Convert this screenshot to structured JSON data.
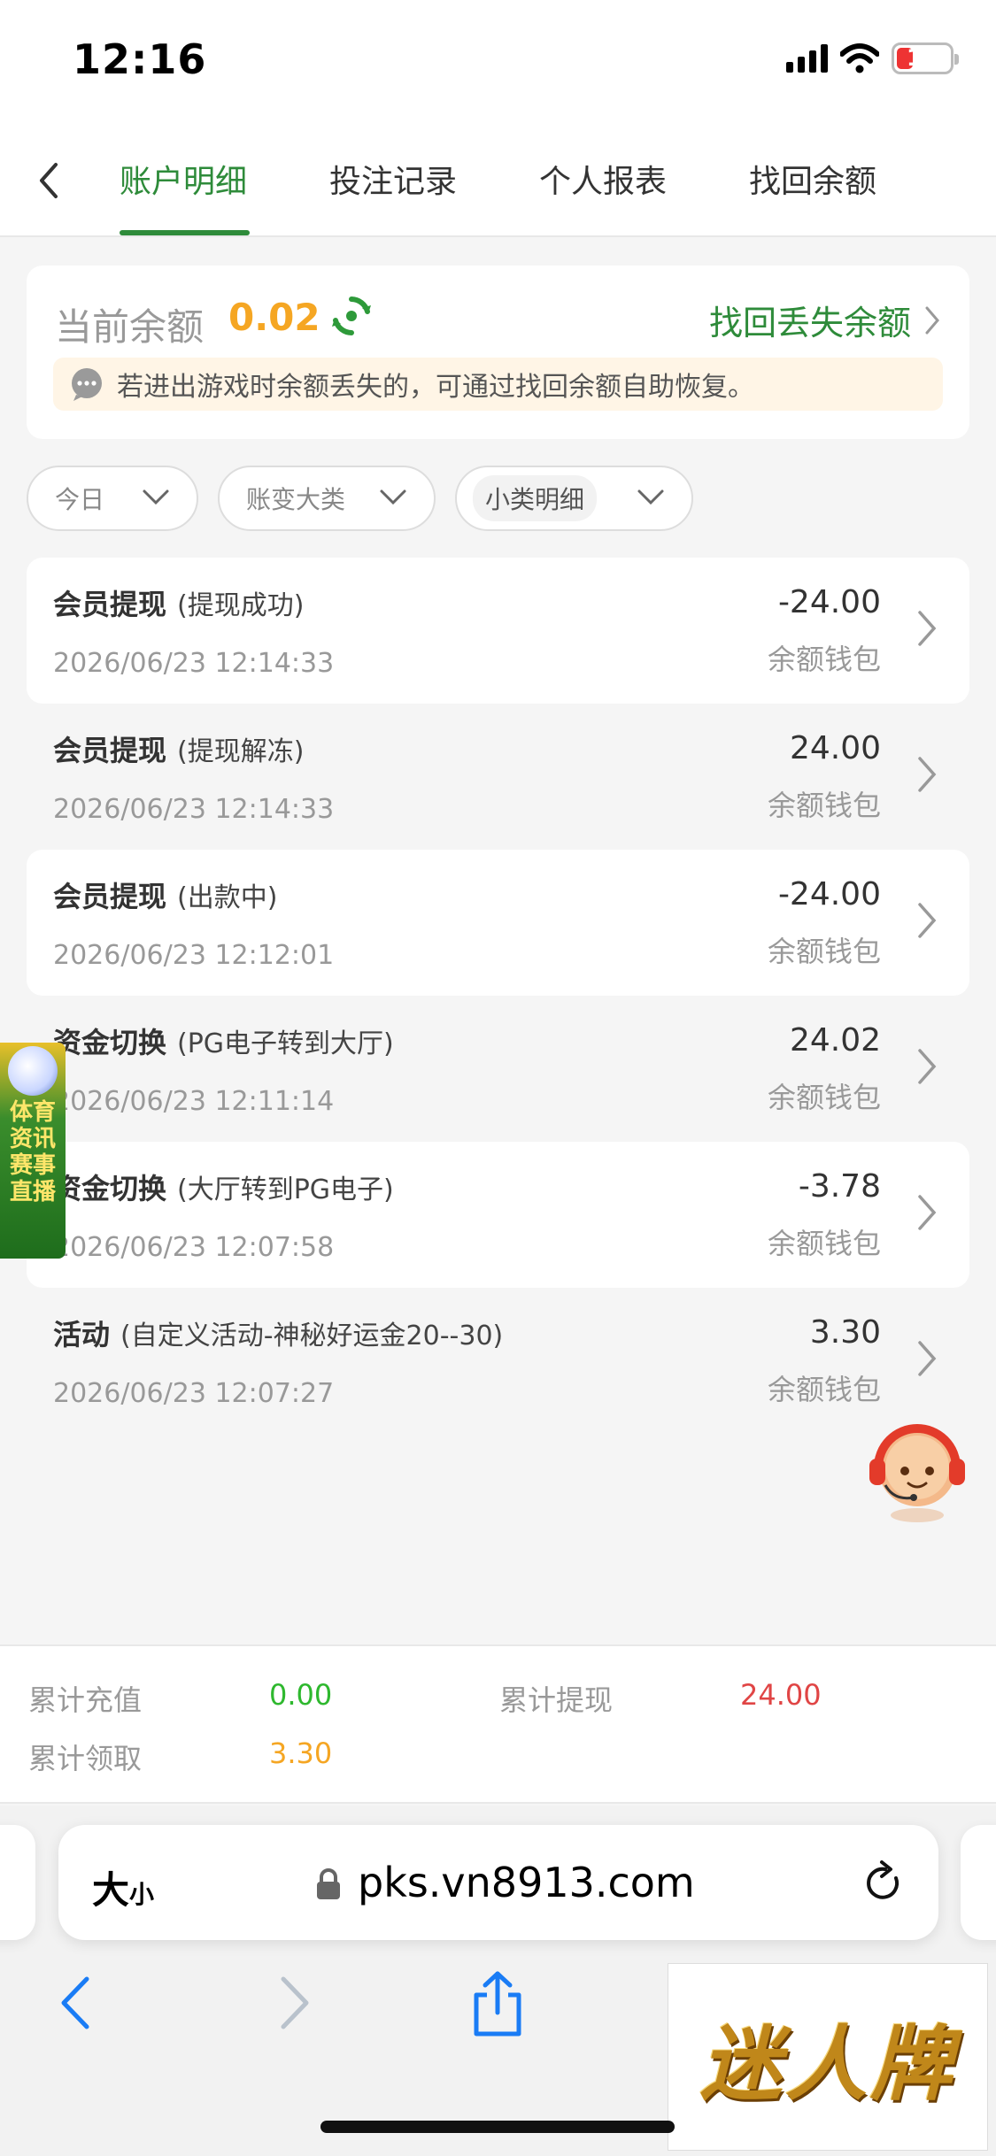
{
  "status_bar": {
    "time": "12:16",
    "battery": "14"
  },
  "nav": {
    "tabs": [
      {
        "label": "账户明细",
        "active": true
      },
      {
        "label": "投注记录",
        "active": false
      },
      {
        "label": "个人报表",
        "active": false
      },
      {
        "label": "找回余额",
        "active": false
      }
    ]
  },
  "balance": {
    "label": "当前余额",
    "value": "0.02",
    "recover_link": "找回丢失余额",
    "notice": "若进出游戏时余额丢失的，可通过找回余额自助恢复。"
  },
  "filters": [
    {
      "label": "今日"
    },
    {
      "label": "账变大类"
    },
    {
      "label": "小类明细"
    }
  ],
  "records": [
    {
      "title": "会员提现",
      "sub": "(提现成功)",
      "time": "2026/06/23 12:14:33",
      "amount": "-24.00",
      "wallet": "余额钱包"
    },
    {
      "title": "会员提现",
      "sub": "(提现解冻)",
      "time": "2026/06/23 12:14:33",
      "amount": "24.00",
      "wallet": "余额钱包"
    },
    {
      "title": "会员提现",
      "sub": "(出款中)",
      "time": "2026/06/23 12:12:01",
      "amount": "-24.00",
      "wallet": "余额钱包"
    },
    {
      "title": "资金切换",
      "sub": "(PG电子转到大厅)",
      "time": "2026/06/23 12:11:14",
      "amount": "24.02",
      "wallet": "余额钱包"
    },
    {
      "title": "资金切换",
      "sub": "(大厅转到PG电子)",
      "time": "2026/06/23 12:07:58",
      "amount": "-3.78",
      "wallet": "余额钱包"
    },
    {
      "title": "活动",
      "sub": "(自定义活动-神秘好运金20--30)",
      "time": "2026/06/23 12:07:27",
      "amount": "3.30",
      "wallet": "余额钱包"
    }
  ],
  "side_badge": {
    "line1": "体育资讯",
    "line2": "赛事直播"
  },
  "summary": {
    "recharge_label": "累计充值",
    "recharge_value": "0.00",
    "withdraw_label": "累计提现",
    "withdraw_value": "24.00",
    "claim_label": "累计领取",
    "claim_value": "3.30"
  },
  "browser": {
    "aa_big": "大",
    "aa_small": "小",
    "url": "pks.vn8913.com"
  },
  "watermark": {
    "text": "迷人牌"
  },
  "colors": {
    "accent_green": "#2e8b3a",
    "balance_orange": "#f5a623",
    "withdraw_red": "#e04545",
    "recharge_green": "#2eb82e"
  }
}
